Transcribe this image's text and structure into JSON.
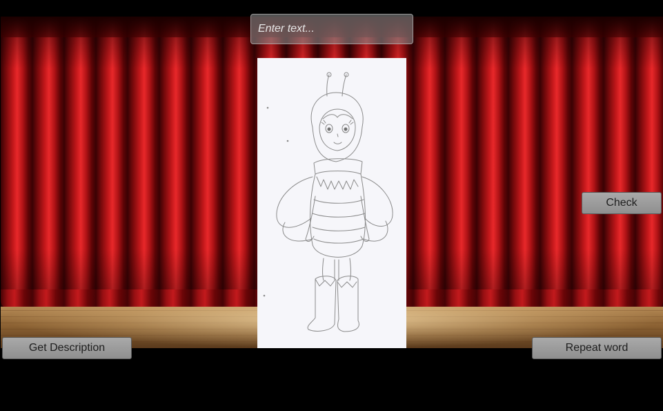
{
  "input": {
    "placeholder": "Enter text...",
    "value": ""
  },
  "buttons": {
    "check": "Check",
    "get_description": "Get Description",
    "repeat_word": "Repeat word"
  },
  "image": {
    "subject": "bee-girl-sketch",
    "background": "theater-stage-curtain"
  },
  "colors": {
    "curtain": "#c4181b",
    "floor": "#8c6233",
    "button": "#9a9a9a",
    "button_text": "#1e1e1e",
    "input_bg": "#8f8f8f",
    "card_bg": "#f6f6fa"
  }
}
